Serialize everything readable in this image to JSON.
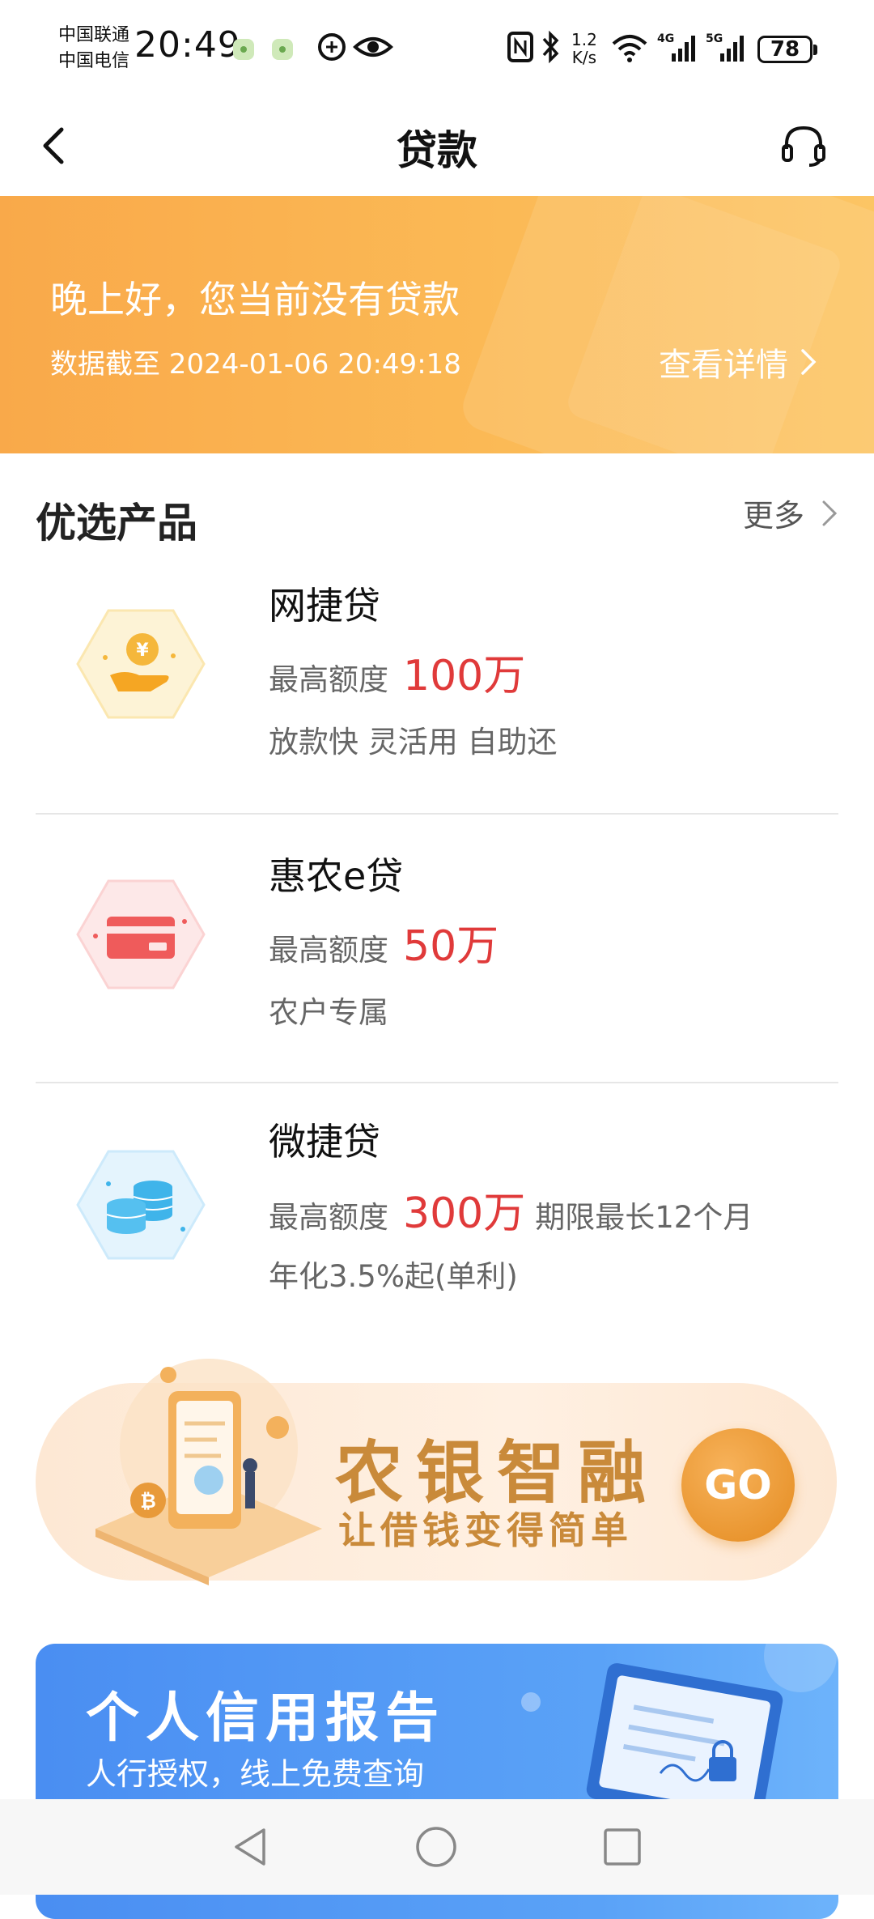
{
  "status_bar": {
    "carrier_1": "中国联通",
    "carrier_2": "中国电信",
    "time": "20:49",
    "net_speed_value": "1.2",
    "net_speed_unit": "K/s",
    "battery": "78"
  },
  "nav": {
    "title": "贷款"
  },
  "banner": {
    "greeting": "晚上好，您当前没有贷款",
    "data_time": "数据截至 2024-01-06 20:49:18",
    "detail_link": "查看详情"
  },
  "section": {
    "title": "优选产品",
    "more": "更多"
  },
  "products": [
    {
      "name": "网捷贷",
      "limit_label": "最高额度",
      "limit_value": "100万",
      "limit_extra": "",
      "desc": "放款快 灵活用 自助还",
      "icon": "hand-coin-icon",
      "icon_color": "#f5b73b"
    },
    {
      "name": "惠农e贷",
      "limit_label": "最高额度",
      "limit_value": "50万",
      "limit_extra": "",
      "desc": "农户专属",
      "icon": "card-icon",
      "icon_color": "#ef5b5b"
    },
    {
      "name": "微捷贷",
      "limit_label": "最高额度",
      "limit_value": "300万",
      "limit_extra": "期限最长12个月",
      "desc": "年化3.5%起(单利)",
      "icon": "coins-stack-icon",
      "icon_color": "#3fb4ea"
    }
  ],
  "promo": {
    "title": "农银智融",
    "subtitle": "让借钱变得简单",
    "button": "GO"
  },
  "credit_report": {
    "title": "个人信用报告",
    "subtitle": "人行授权，线上免费查询"
  },
  "colors": {
    "accent_red": "#e03a3a",
    "banner_orange": "#f9a94a",
    "promo_gold": "#c98a3a",
    "credit_blue": "#4a8ef2"
  }
}
